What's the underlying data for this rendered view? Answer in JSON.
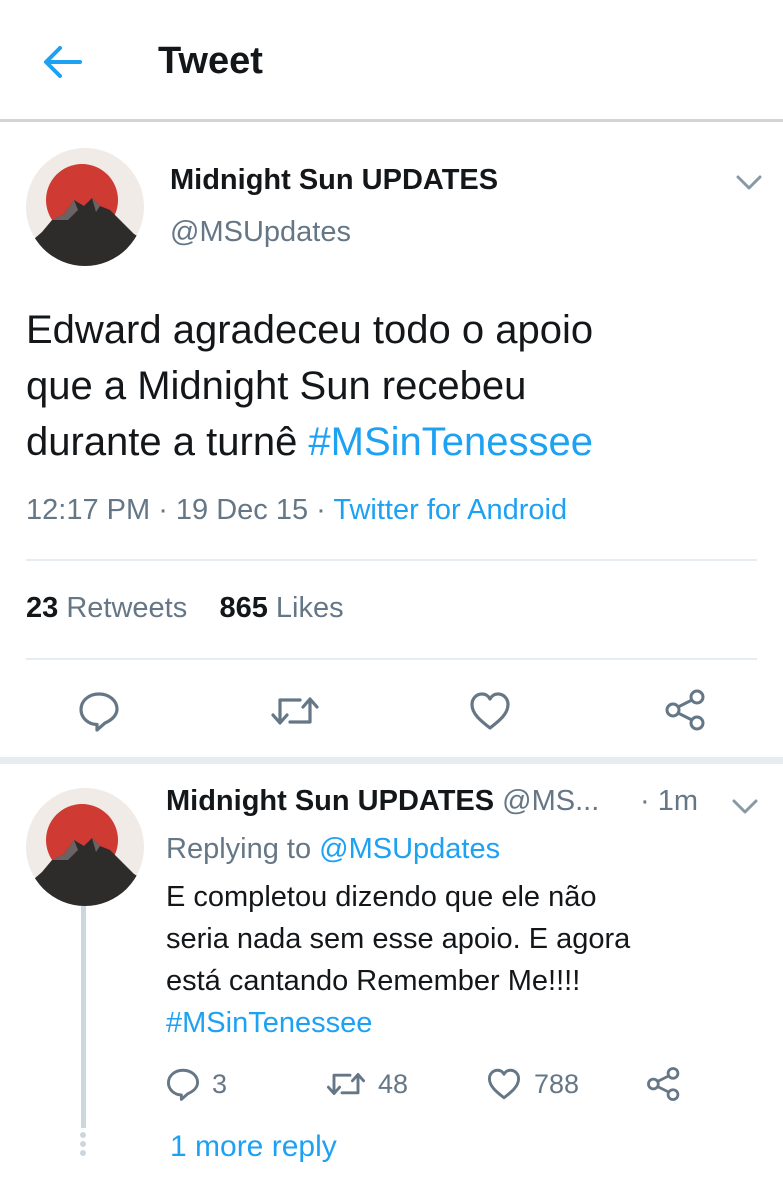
{
  "header": {
    "title": "Tweet",
    "back_icon": "arrow-left-icon"
  },
  "colors": {
    "link": "#1da1f2",
    "secondary_text": "#657786",
    "primary_text": "#14171a",
    "avatar_sun": "#cf3a33",
    "divider": "#e6ecf0"
  },
  "tweet": {
    "author_name": "Midnight Sun UPDATES",
    "author_handle": "@MSUpdates",
    "text_lines": [
      "Edward agradeceu todo o apoio",
      "que a Midnight Sun recebeu",
      "durante a turnê "
    ],
    "hashtag": "#MSinTenessee",
    "time": "12:17 PM",
    "dot1": " · ",
    "date": "19 Dec 15",
    "dot2": " · ",
    "source": "Twitter for Android",
    "retweets_count": "23",
    "retweets_label": "Retweets",
    "likes_count": "865",
    "likes_label": "Likes"
  },
  "reply": {
    "author_name": "Midnight Sun UPDATES",
    "author_handle": "@MS...",
    "time": "· 1m",
    "replying_prefix": "Replying to ",
    "replying_handle": "@MSUpdates",
    "text_lines": [
      "E completou dizendo que ele não",
      "seria nada sem esse apoio. E agora",
      "está cantando Remember Me!!!!"
    ],
    "hashtag": "#MSinTenessee",
    "reply_count": "3",
    "retweet_count": "48",
    "like_count": "788"
  },
  "more_replies": "1 more reply"
}
